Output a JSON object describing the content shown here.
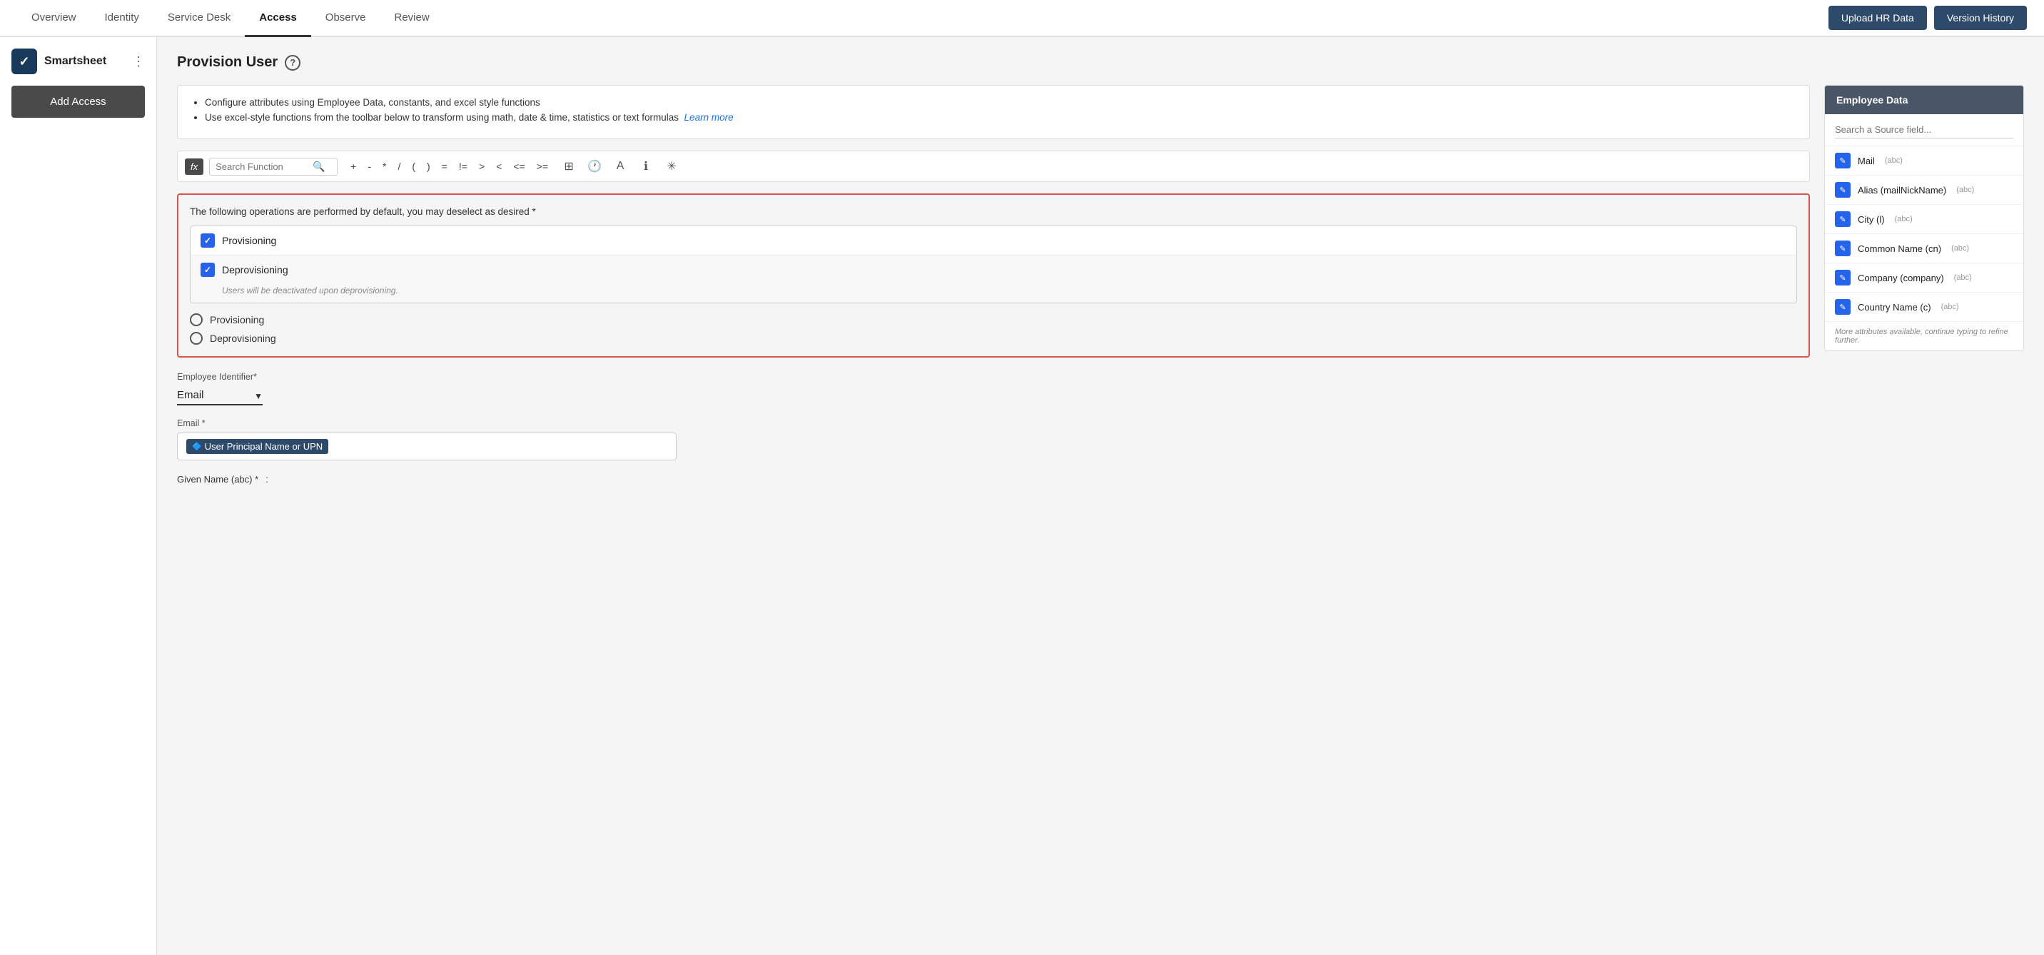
{
  "nav": {
    "tabs": [
      {
        "label": "Overview",
        "active": false
      },
      {
        "label": "Identity",
        "active": false
      },
      {
        "label": "Service Desk",
        "active": false
      },
      {
        "label": "Access",
        "active": true
      },
      {
        "label": "Observe",
        "active": false
      },
      {
        "label": "Review",
        "active": false
      }
    ],
    "upload_hr_btn": "Upload HR Data",
    "version_history_btn": "Version History"
  },
  "sidebar": {
    "brand_name": "Smartsheet",
    "add_access_btn": "Add Access"
  },
  "main": {
    "page_title": "Provision User",
    "info_bullets": [
      "Configure attributes using Employee Data, constants, and excel style functions",
      "Use excel-style functions from the toolbar below to transform using math, date & time, statistics or text formulas"
    ],
    "learn_more_link": "Learn more",
    "toolbar": {
      "fx_label": "fx",
      "search_placeholder": "Search Function",
      "operators": [
        "+",
        "-",
        "*",
        "/",
        "(",
        ")",
        "=",
        "!=",
        ">",
        "<",
        "<=",
        ">="
      ]
    },
    "operations_note": "The following operations are performed by default, you may deselect as desired *",
    "checkboxes": [
      {
        "label": "Provisioning",
        "checked": true
      },
      {
        "label": "Deprovisioning",
        "checked": true,
        "sublabel": "Users will be deactivated upon deprovisioning."
      }
    ],
    "radio_options": [
      {
        "label": "Provisioning"
      },
      {
        "label": "Deprovisioning"
      }
    ],
    "employee_identifier_label": "Employee Identifier*",
    "employee_identifier_value": "Email",
    "email_label": "Email *",
    "email_token": "User Principal Name or UPN",
    "given_name_label": "Given Name (abc) *"
  },
  "employee_data": {
    "header": "Employee Data",
    "search_placeholder": "Search a Source field...",
    "items": [
      {
        "name": "Mail",
        "type": "(abc)"
      },
      {
        "name": "Alias (mailNickName)",
        "type": "(abc)"
      },
      {
        "name": "City (l)",
        "type": "(abc)"
      },
      {
        "name": "Common Name (cn)",
        "type": "(abc)"
      },
      {
        "name": "Company (company)",
        "type": "(abc)"
      },
      {
        "name": "Country Name (c)",
        "type": "(abc)"
      }
    ],
    "more_text": "More attributes available, continue typing to refine further."
  }
}
